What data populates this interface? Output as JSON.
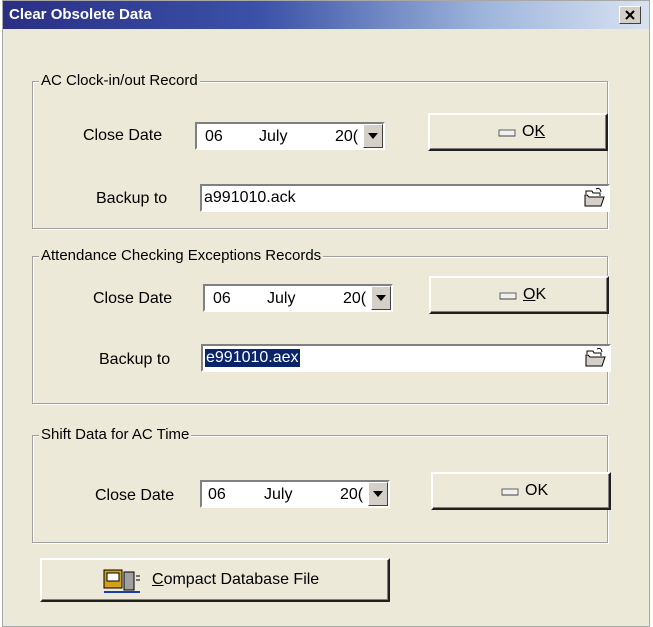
{
  "window": {
    "title": "Clear Obsolete Data"
  },
  "sections": [
    {
      "legend": "AC Clock-in/out Record",
      "close_date_label": "Close Date",
      "date": {
        "day": "06",
        "month": "July",
        "year": "20("
      },
      "ok_label": "OK",
      "ok_mnemonic": "K",
      "backup_label": "Backup to",
      "backup_value": "a991010.ack"
    },
    {
      "legend": "Attendance Checking Exceptions Records",
      "close_date_label": "Close Date",
      "date": {
        "day": "06",
        "month": "July",
        "year": "20("
      },
      "ok_label": "OK",
      "ok_mnemonic": "O",
      "backup_label": "Backup to",
      "backup_value": "e991010.aex"
    },
    {
      "legend": "Shift Data for AC Time",
      "close_date_label": "Close Date",
      "date": {
        "day": "06",
        "month": "July",
        "year": "20("
      },
      "ok_label": "OK"
    }
  ],
  "compact": {
    "label_first": "C",
    "label_rest": "ompact Database File"
  },
  "icons": {
    "close": "close-icon",
    "dropdown": "dropdown-arrow-icon",
    "ok": "eraser-icon",
    "browse": "open-folder-icon",
    "compact": "database-compact-icon"
  }
}
